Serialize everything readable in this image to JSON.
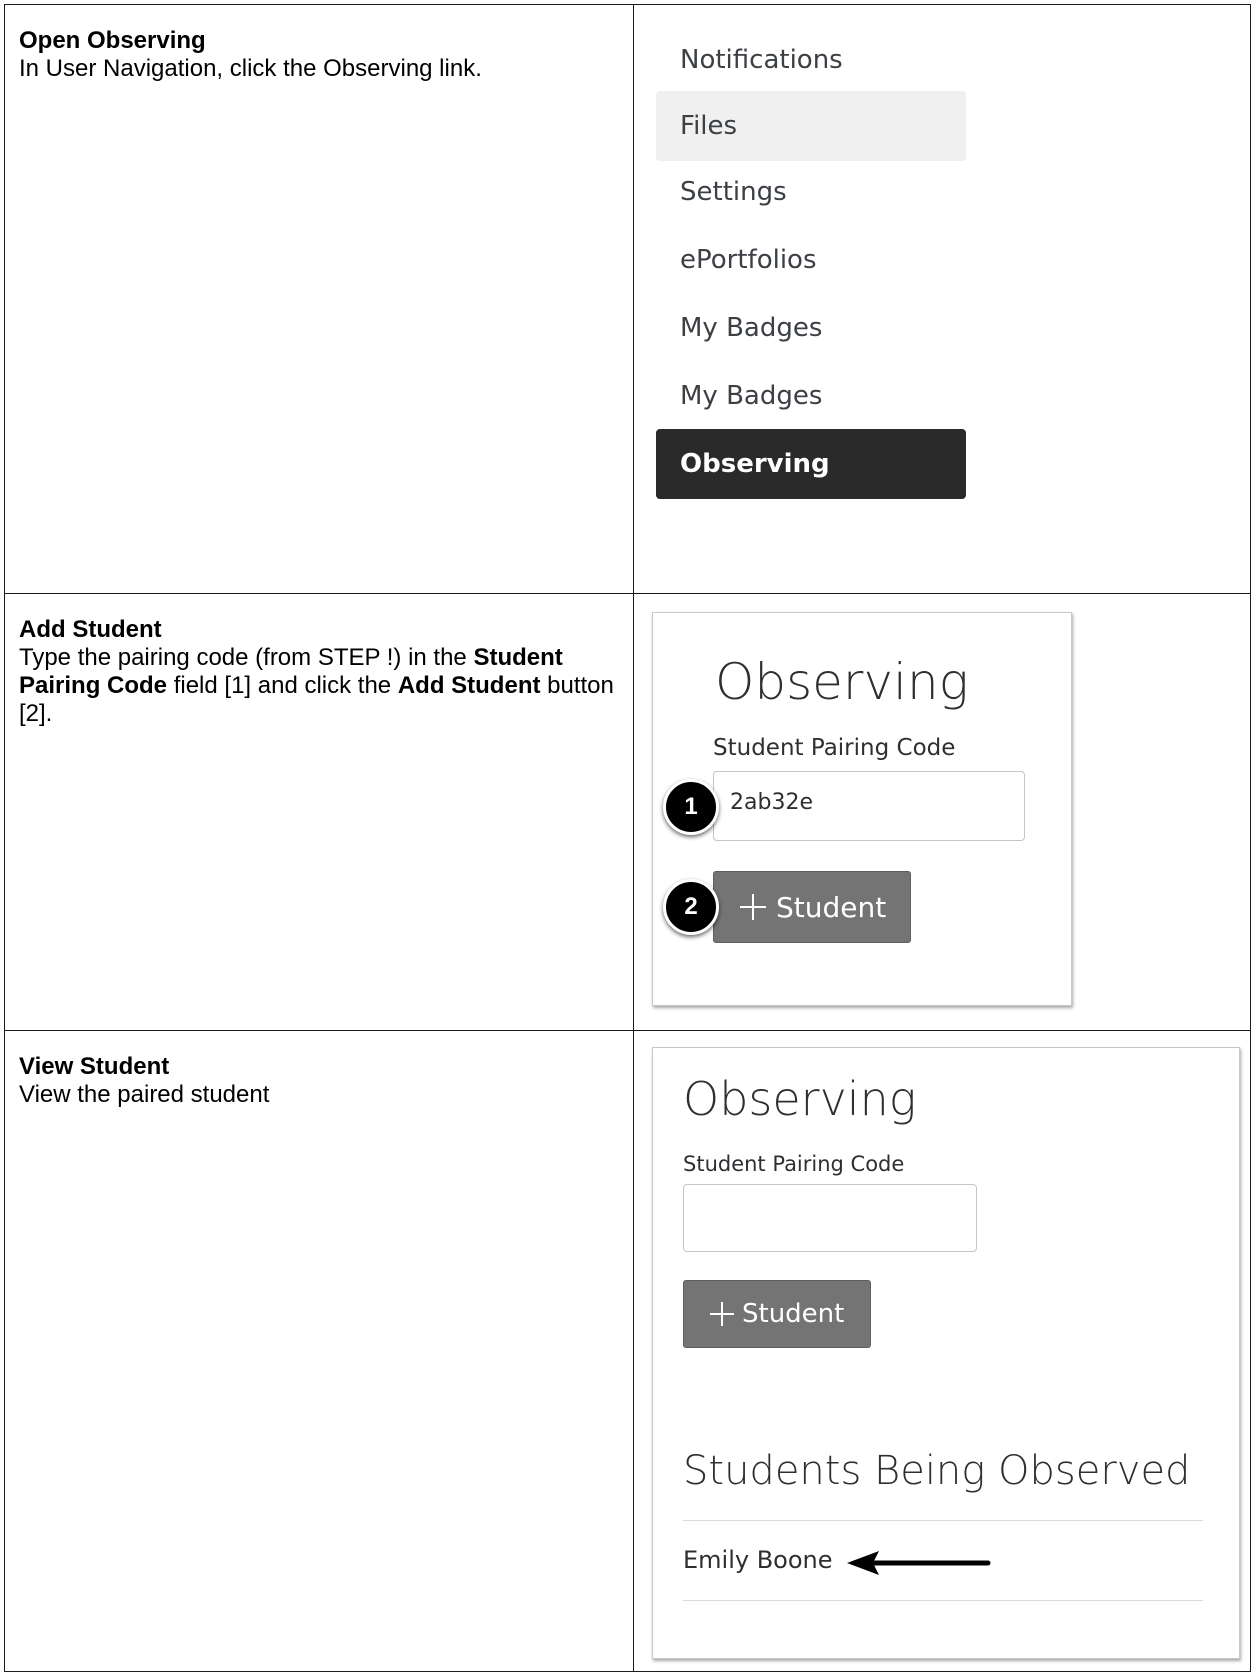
{
  "steps": [
    {
      "title": "Open Observing",
      "description": "In User Navigation, click the Observing link."
    },
    {
      "title": "Add Student",
      "description_parts": [
        "Type the pairing code (from STEP !) in the ",
        "Student Pairing Code",
        " field [1] and click the ",
        "Add Student",
        " button [2]."
      ]
    },
    {
      "title": "View Student",
      "description": "View the paired student"
    }
  ],
  "user_nav": {
    "items": [
      "Notifications",
      "Files",
      "Settings",
      "ePortfolios",
      "My Badges",
      "My Badges",
      "Observing"
    ],
    "hover_index": 1,
    "active_index": 6
  },
  "add_student_shot": {
    "title": "Observing",
    "code_label": "Student Pairing Code",
    "code_value": "2ab32e",
    "button_label": "Student",
    "callouts": [
      "1",
      "2"
    ]
  },
  "view_student_shot": {
    "title": "Observing",
    "code_label": "Student Pairing Code",
    "code_value": "",
    "button_label": "Student",
    "observed_heading": "Students Being Observed",
    "students": [
      "Emily Boone"
    ]
  }
}
